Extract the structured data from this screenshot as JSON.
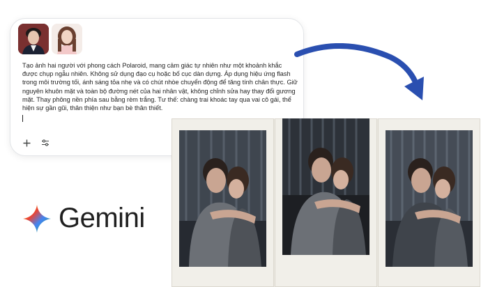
{
  "prompt": {
    "text": "Tạo ảnh hai người với phong cách Polaroid, mang cảm giác tự nhiên như một khoảnh khắc được chụp ngẫu nhiên. Không sử dụng đạo cụ hoặc bố cục dàn dựng. Áp dụng hiệu ứng flash trong môi trường tối, ánh sáng tỏa nhẹ và có chút nhòe chuyển động để tăng tính chân thực. Giữ nguyên khuôn mặt và toàn bộ đường nét của hai nhân vật, không chỉnh sửa hay thay đổi gương mặt. Thay phông nền phía sau bằng rèm trắng. Tư thế: chàng trai khoác tay qua vai cô gái, thể hiện sự gần gũi, thân thiện như bạn bè thân thiết.",
    "add_icon": "plus-icon",
    "tools_icon": "tune-icon"
  },
  "brand": {
    "name": "Gemini",
    "logo_icon": "gemini-sparkle-icon"
  },
  "colors": {
    "arrow": "#2a4fb0",
    "card_border": "#e3e5e8",
    "polaroid_frame": "#f1efe9"
  }
}
